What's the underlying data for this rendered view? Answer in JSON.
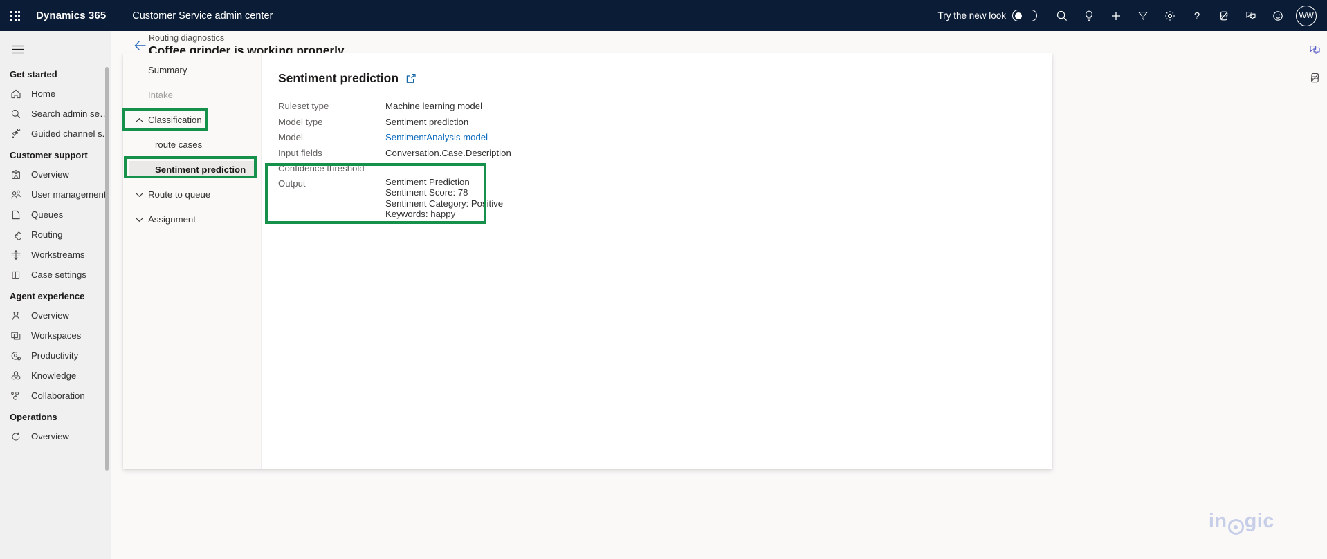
{
  "suitebar": {
    "waffle_label": "app-launcher",
    "brand": "Dynamics 365",
    "app_name": "Customer Service admin center",
    "new_look_label": "Try the new look",
    "new_look_state": "off",
    "avatar_initials": "WW",
    "icons": [
      "search-icon",
      "lightbulb-icon",
      "plus-icon",
      "filter-icon",
      "gear-icon",
      "help-icon",
      "diagnostics-icon",
      "feedback-icon",
      "smiley-icon"
    ]
  },
  "leftnav": {
    "hamburger_label": "Show nav menu",
    "groups": [
      {
        "title": "Get started",
        "items": [
          {
            "label": "Home",
            "icon": "home-icon"
          },
          {
            "label": "Search admin sett...",
            "icon": "search-icon"
          },
          {
            "label": "Guided channel s...",
            "icon": "rocket-icon"
          }
        ]
      },
      {
        "title": "Customer support",
        "items": [
          {
            "label": "Overview",
            "icon": "overview-icon"
          },
          {
            "label": "User management",
            "icon": "users-icon"
          },
          {
            "label": "Queues",
            "icon": "queues-icon"
          },
          {
            "label": "Routing",
            "icon": "routing-icon"
          },
          {
            "label": "Workstreams",
            "icon": "workstreams-icon"
          },
          {
            "label": "Case settings",
            "icon": "case-settings-icon"
          }
        ]
      },
      {
        "title": "Agent experience",
        "items": [
          {
            "label": "Overview",
            "icon": "agent-overview-icon"
          },
          {
            "label": "Workspaces",
            "icon": "workspaces-icon"
          },
          {
            "label": "Productivity",
            "icon": "productivity-icon"
          },
          {
            "label": "Knowledge",
            "icon": "knowledge-icon"
          },
          {
            "label": "Collaboration",
            "icon": "collaboration-icon"
          }
        ]
      },
      {
        "title": "Operations",
        "items": [
          {
            "label": "Overview",
            "icon": "operations-overview-icon"
          }
        ]
      }
    ]
  },
  "rightrail": {
    "icons": [
      "feedback-icon",
      "diagnostics-icon"
    ]
  },
  "page": {
    "breadcrumb": "Routing diagnostics",
    "title": "Coffee grinder is working properly",
    "back_label": "Back"
  },
  "tree": {
    "items": [
      {
        "label": "Summary",
        "type": "item",
        "state": "normal"
      },
      {
        "label": "Intake",
        "type": "item",
        "state": "disabled"
      },
      {
        "label": "Classification",
        "type": "group",
        "state": "expanded",
        "chevron": "chevron-up-icon"
      },
      {
        "label": "route cases",
        "type": "child",
        "state": "normal"
      },
      {
        "label": "Sentiment prediction",
        "type": "child",
        "state": "selected"
      },
      {
        "label": "Route to queue",
        "type": "group",
        "state": "collapsed",
        "chevron": "chevron-down-icon"
      },
      {
        "label": "Assignment",
        "type": "group",
        "state": "collapsed",
        "chevron": "chevron-down-icon"
      }
    ]
  },
  "detail": {
    "title": "Sentiment prediction",
    "popout_label": "open-in-new-window",
    "fields": [
      {
        "label": "Ruleset type",
        "value": "Machine learning model",
        "kind": "text"
      },
      {
        "label": "Model type",
        "value": "Sentiment prediction",
        "kind": "text"
      },
      {
        "label": "Model",
        "value": "SentimentAnalysis model",
        "kind": "link"
      },
      {
        "label": "Input fields",
        "value": "Conversation.Case.Description",
        "kind": "text"
      },
      {
        "label": "Confidence threshold",
        "value": "---",
        "kind": "text"
      }
    ],
    "output": {
      "label": "Output",
      "lines": [
        "Sentiment Prediction",
        "Sentiment Score: 78",
        "Sentiment Category: Positive",
        "Keywords: happy"
      ]
    }
  },
  "annotations": {
    "color": "#16914b",
    "boxes": [
      "classification-highlight",
      "sentiment-prediction-highlight",
      "output-highlight"
    ]
  },
  "watermark": {
    "text_before": "in",
    "text_after": "gic",
    "full": "inogic",
    "color": "#c5cce8"
  }
}
